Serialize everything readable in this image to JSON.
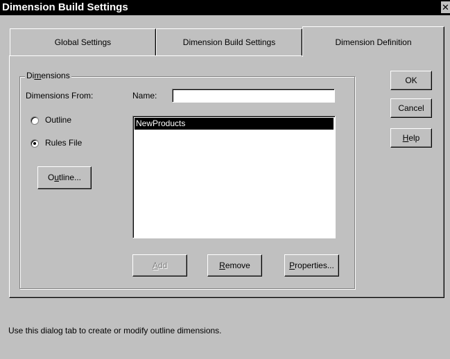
{
  "window": {
    "title": "Dimension Build Settings",
    "close_glyph": "✕"
  },
  "tabs": [
    {
      "label": "Global Settings",
      "active": false
    },
    {
      "label": "Dimension Build Settings",
      "active": false
    },
    {
      "label": "Dimension Definition",
      "active": true
    }
  ],
  "dimensions_group": {
    "label_pre": "Di",
    "label_mnemonic": "m",
    "label_post": "ensions",
    "from_label": "Dimensions From:",
    "radio_outline": {
      "label": "Outline",
      "checked": false
    },
    "radio_rules": {
      "label": "Rules File",
      "checked": true
    },
    "outline_button": {
      "pre": "O",
      "mnemonic": "u",
      "post": "tline..."
    },
    "name_label": "Name:",
    "name_value": "",
    "list_items": [
      "NewProducts"
    ],
    "add_button": {
      "mnemonic": "A",
      "post": "dd",
      "enabled": false
    },
    "remove_button": {
      "mnemonic": "R",
      "post": "emove"
    },
    "properties_button": {
      "mnemonic": "P",
      "post": "roperties..."
    }
  },
  "side_buttons": {
    "ok": "OK",
    "cancel": "Cancel",
    "help": {
      "mnemonic": "H",
      "post": "elp"
    }
  },
  "status_text": "Use this dialog tab to create or modify outline dimensions."
}
